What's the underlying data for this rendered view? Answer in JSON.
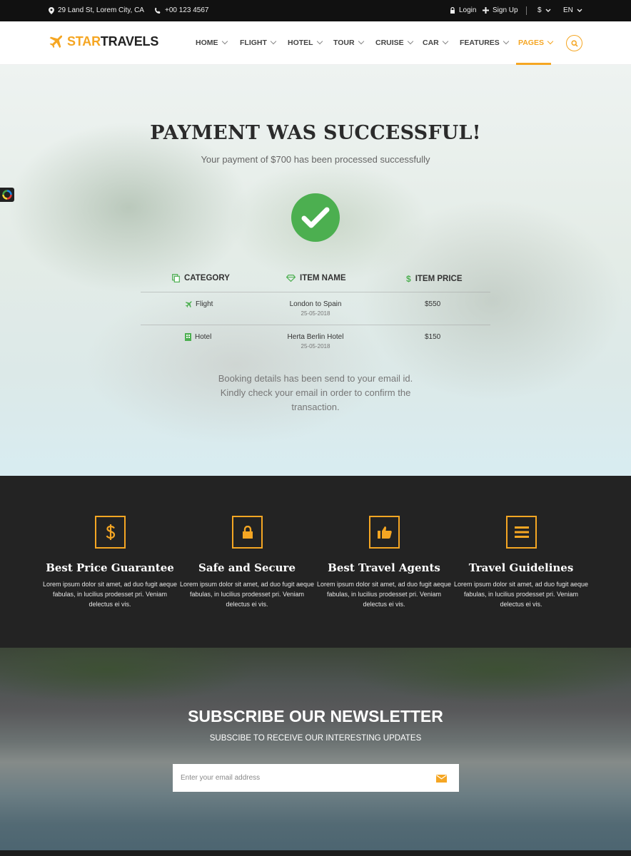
{
  "topbar": {
    "address": "29 Land St, Lorem City, CA",
    "phone": "+00 123 4567",
    "login": "Login",
    "signup": "Sign Up",
    "currency": "$",
    "language": "EN"
  },
  "header": {
    "logo_part1": "STAR",
    "logo_part2": "TRAVELS",
    "nav": [
      "HOME",
      "FLIGHT",
      "HOTEL",
      "TOUR",
      "CRUISE",
      "CAR",
      "FEATURES",
      "PAGES"
    ],
    "active_nav": "PAGES"
  },
  "hero": {
    "title": "PAYMENT WAS SUCCESSFUL!",
    "subtitle": "Your payment of $700 has been processed successfully",
    "table": {
      "headers": [
        "CATEGORY",
        "ITEM NAME",
        "ITEM PRICE"
      ],
      "rows": [
        {
          "category": "Flight",
          "item": "London to Spain",
          "date": "25-05-2018",
          "price": "$550"
        },
        {
          "category": "Hotel",
          "item": "Herta Berlin Hotel",
          "date": "25-05-2018",
          "price": "$150"
        }
      ]
    },
    "note": "Booking details has been send to your email id. Kindly check your email in order to confirm the transaction."
  },
  "features": [
    {
      "icon": "dollar-icon",
      "title": "Best Price Guarantee",
      "text": "Lorem ipsum dolor sit amet, ad duo fugit aeque fabulas, in lucilius prodesset pri. Veniam delectus ei vis."
    },
    {
      "icon": "lock-icon",
      "title": "Safe and Secure",
      "text": "Lorem ipsum dolor sit amet, ad duo fugit aeque fabulas, in lucilius prodesset pri. Veniam delectus ei vis."
    },
    {
      "icon": "thumbs-up-icon",
      "title": "Best Travel Agents",
      "text": "Lorem ipsum dolor sit amet, ad duo fugit aeque fabulas, in lucilius prodesset pri. Veniam delectus ei vis."
    },
    {
      "icon": "list-icon",
      "title": "Travel Guidelines",
      "text": "Lorem ipsum dolor sit amet, ad duo fugit aeque fabulas, in lucilius prodesset pri. Veniam delectus ei vis."
    }
  ],
  "newsletter": {
    "title": "SUBSCRIBE OUR NEWSLETTER",
    "subtitle": "SUBSCIBE TO RECEIVE OUR INTERESTING UPDATES",
    "placeholder": "Enter your email address"
  },
  "colors": {
    "accent": "#f5a623",
    "success": "#4caf50",
    "dark": "#232323"
  }
}
